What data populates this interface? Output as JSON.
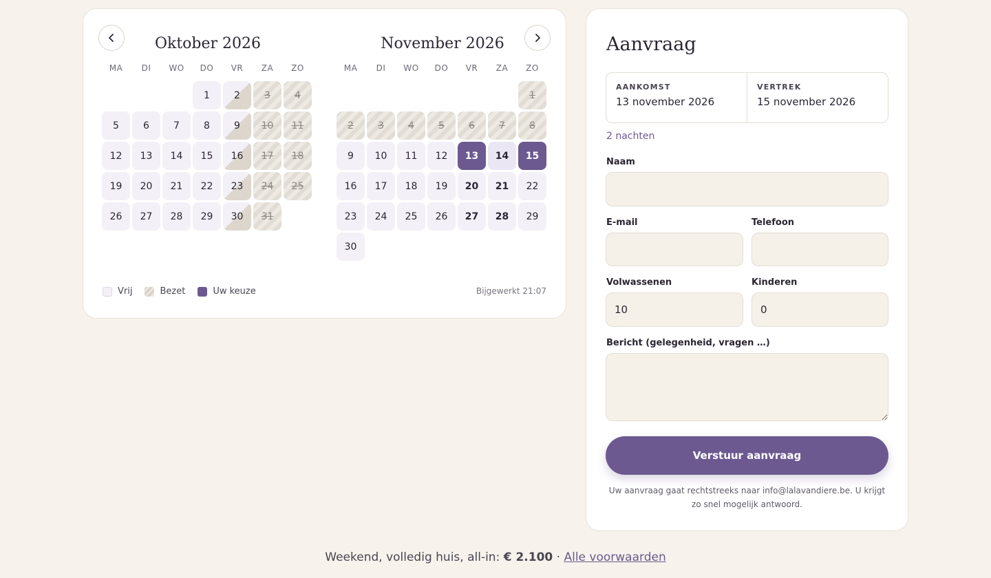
{
  "calendar": {
    "weekdays": [
      "MA",
      "DI",
      "WO",
      "DO",
      "VR",
      "ZA",
      "ZO"
    ],
    "months": [
      {
        "title": "Oktober 2026",
        "offset": 3,
        "days": [
          {
            "n": "1",
            "s": "free"
          },
          {
            "n": "2",
            "s": "half"
          },
          {
            "n": "3",
            "s": "busy"
          },
          {
            "n": "4",
            "s": "busy"
          },
          {
            "n": "5",
            "s": "free"
          },
          {
            "n": "6",
            "s": "free"
          },
          {
            "n": "7",
            "s": "free"
          },
          {
            "n": "8",
            "s": "free"
          },
          {
            "n": "9",
            "s": "half"
          },
          {
            "n": "10",
            "s": "busy"
          },
          {
            "n": "11",
            "s": "busy"
          },
          {
            "n": "12",
            "s": "free"
          },
          {
            "n": "13",
            "s": "free"
          },
          {
            "n": "14",
            "s": "free"
          },
          {
            "n": "15",
            "s": "free"
          },
          {
            "n": "16",
            "s": "half"
          },
          {
            "n": "17",
            "s": "busy"
          },
          {
            "n": "18",
            "s": "busy"
          },
          {
            "n": "19",
            "s": "free"
          },
          {
            "n": "20",
            "s": "free"
          },
          {
            "n": "21",
            "s": "free"
          },
          {
            "n": "22",
            "s": "free"
          },
          {
            "n": "23",
            "s": "half"
          },
          {
            "n": "24",
            "s": "busy"
          },
          {
            "n": "25",
            "s": "busy"
          },
          {
            "n": "26",
            "s": "free"
          },
          {
            "n": "27",
            "s": "free"
          },
          {
            "n": "28",
            "s": "free"
          },
          {
            "n": "29",
            "s": "free"
          },
          {
            "n": "30",
            "s": "half"
          },
          {
            "n": "31",
            "s": "busy"
          }
        ]
      },
      {
        "title": "November 2026",
        "offset": 6,
        "days": [
          {
            "n": "1",
            "s": "busy"
          },
          {
            "n": "2",
            "s": "busy"
          },
          {
            "n": "3",
            "s": "busy"
          },
          {
            "n": "4",
            "s": "busy"
          },
          {
            "n": "5",
            "s": "busy"
          },
          {
            "n": "6",
            "s": "busy"
          },
          {
            "n": "7",
            "s": "busy"
          },
          {
            "n": "8",
            "s": "busy"
          },
          {
            "n": "9",
            "s": "free"
          },
          {
            "n": "10",
            "s": "free"
          },
          {
            "n": "11",
            "s": "free"
          },
          {
            "n": "12",
            "s": "free"
          },
          {
            "n": "13",
            "s": "sel"
          },
          {
            "n": "14",
            "s": "range"
          },
          {
            "n": "15",
            "s": "sel"
          },
          {
            "n": "16",
            "s": "free"
          },
          {
            "n": "17",
            "s": "free"
          },
          {
            "n": "18",
            "s": "free"
          },
          {
            "n": "19",
            "s": "free"
          },
          {
            "n": "20",
            "s": "wk"
          },
          {
            "n": "21",
            "s": "wk"
          },
          {
            "n": "22",
            "s": "free"
          },
          {
            "n": "23",
            "s": "free"
          },
          {
            "n": "24",
            "s": "free"
          },
          {
            "n": "25",
            "s": "free"
          },
          {
            "n": "26",
            "s": "free"
          },
          {
            "n": "27",
            "s": "wk"
          },
          {
            "n": "28",
            "s": "wk"
          },
          {
            "n": "29",
            "s": "free"
          },
          {
            "n": "30",
            "s": "free"
          }
        ]
      }
    ],
    "legend": {
      "free": "Vrij",
      "busy": "Bezet",
      "selected": "Uw keuze"
    },
    "updated": "Bijgewerkt 21:07",
    "colors": {
      "selected": "#6c5990",
      "free": "#f3f0f8",
      "busy": "#e1dcd4"
    }
  },
  "form": {
    "title": "Aanvraag",
    "arrival_label": "AANKOMST",
    "arrival_value": "13 november 2026",
    "departure_label": "VERTREK",
    "departure_value": "15 november 2026",
    "nights": "2 nachten",
    "name_label": "Naam",
    "name_value": "",
    "email_label": "E-mail",
    "email_value": "",
    "phone_label": "Telefoon",
    "phone_value": "",
    "adults_label": "Volwassenen",
    "adults_value": "10",
    "children_label": "Kinderen",
    "children_value": "0",
    "message_label": "Bericht (gelegenheid, vragen …)",
    "message_value": "",
    "submit_label": "Verstuur aanvraag",
    "note": "Uw aanvraag gaat rechtstreeks naar info@lalavandiere.be. U krijgt zo snel mogelijk antwoord."
  },
  "footer": {
    "text": "Weekend, volledig huis, all-in:",
    "price": "€ 2.100",
    "separator": "·",
    "link": "Alle voorwaarden"
  }
}
